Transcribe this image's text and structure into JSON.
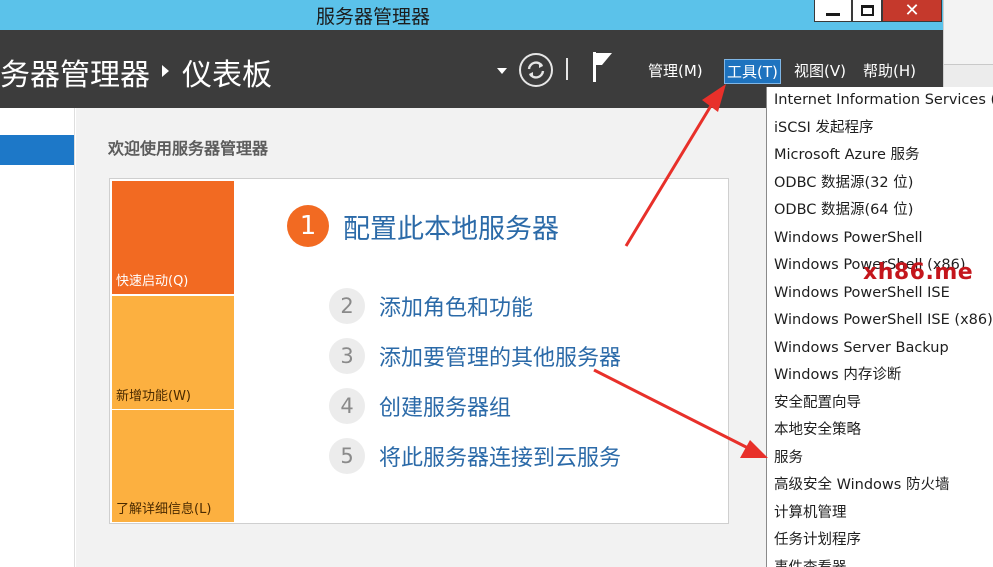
{
  "window": {
    "title": "服务器管理器",
    "close_glyph": "✕"
  },
  "header": {
    "breadcrumb_root": "务器管理器",
    "breadcrumb_current": "仪表板",
    "menus": {
      "manage": "管理(M)",
      "tools": "工具(T)",
      "view": "视图(V)",
      "help": "帮助(H)"
    }
  },
  "main": {
    "welcome_title": "欢迎使用服务器管理器",
    "tiles": [
      {
        "label": "快速启动(Q)",
        "color": "#f26a22"
      },
      {
        "label": "新增功能(W)",
        "color": "#fcb040"
      },
      {
        "label": "了解详细信息(L)",
        "color": "#fcb040"
      }
    ],
    "steps": [
      {
        "num": "1",
        "label": "配置此本地服务器"
      },
      {
        "num": "2",
        "label": "添加角色和功能"
      },
      {
        "num": "3",
        "label": "添加要管理的其他服务器"
      },
      {
        "num": "4",
        "label": "创建服务器组"
      },
      {
        "num": "5",
        "label": "将此服务器连接到云服务"
      }
    ]
  },
  "tools_menu": {
    "items": [
      "Internet Information Services (",
      "iSCSI 发起程序",
      "Microsoft Azure 服务",
      "ODBC 数据源(32 位)",
      "ODBC 数据源(64 位)",
      "Windows PowerShell",
      "Windows PowerShell (x86)",
      "Windows PowerShell ISE",
      "Windows PowerShell ISE (x86)",
      "Windows Server Backup",
      "Windows 内存诊断",
      "安全配置向导",
      "本地安全策略",
      "服务",
      "高级安全 Windows 防火墙",
      "计算机管理",
      "任务计划程序",
      "事件查看器"
    ]
  },
  "watermark": "xh86.me",
  "colors": {
    "accent_blue": "#1d78c8",
    "tile_orange": "#f26a22",
    "tile_yellow": "#fcb040",
    "annotation_red": "#e8302a",
    "titlebar": "#5bc2ea",
    "header": "#3c3c3c"
  }
}
